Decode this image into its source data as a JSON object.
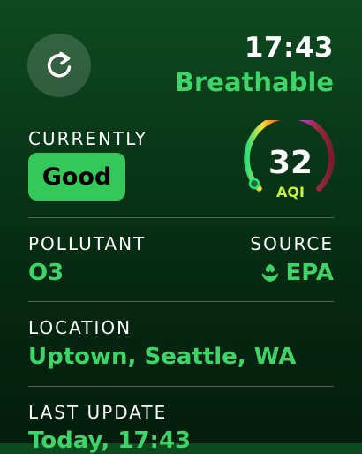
{
  "header": {
    "time": "17:43",
    "status": "Breathable",
    "refresh_icon": "refresh-icon"
  },
  "currently": {
    "label": "CURRENTLY",
    "badge": "Good"
  },
  "aqi": {
    "value": "32",
    "unit": "AQI",
    "level": 32,
    "max": 500
  },
  "pollutant": {
    "label": "POLLUTANT",
    "value": "O3"
  },
  "source": {
    "label": "SOURCE",
    "value": "EPA",
    "icon": "epa-leaf-icon"
  },
  "location": {
    "label": "LOCATION",
    "value": "Uptown, Seattle, WA"
  },
  "last_update": {
    "label": "LAST UPDATE",
    "value": "Today, 17:43"
  },
  "colors": {
    "accent": "#3ed468",
    "badge": "#34c759",
    "aqi_unit": "#c7f03c"
  }
}
